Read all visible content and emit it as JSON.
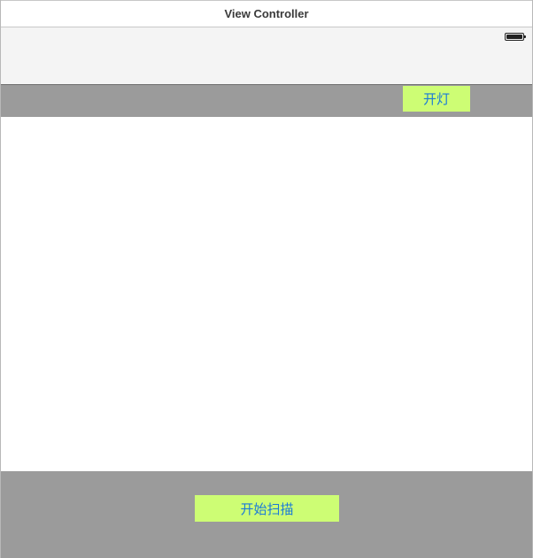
{
  "window": {
    "title": "View Controller"
  },
  "status_bar": {
    "battery_icon": "battery-full-icon",
    "battery_level": 1.0
  },
  "top_toolbar": {
    "light_button_label": "开灯"
  },
  "bottom_toolbar": {
    "scan_button_label": "开始扫描"
  },
  "colors": {
    "toolbar_background": "#9b9b9b",
    "button_background": "#cdfd74",
    "button_text": "#1a7ad8",
    "status_area_background": "#f4f4f4"
  }
}
